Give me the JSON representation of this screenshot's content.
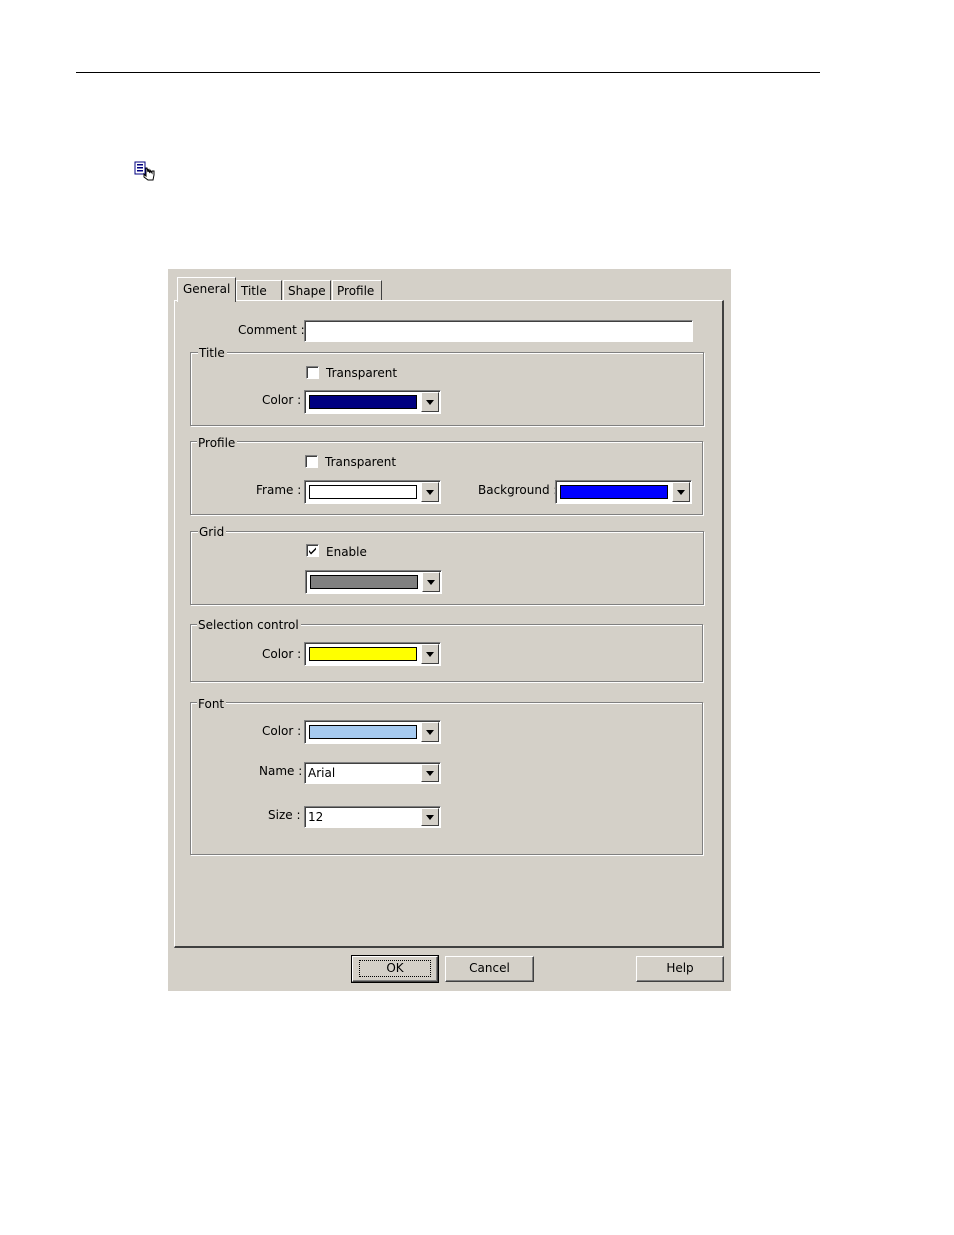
{
  "page": {
    "rule": "horizontal-rule",
    "icon": "properties-hand-icon"
  },
  "dialog": {
    "tabs": [
      {
        "label": "General",
        "active": true
      },
      {
        "label": "Title",
        "active": false
      },
      {
        "label": "Shape",
        "active": false
      },
      {
        "label": "Profile",
        "active": false
      }
    ],
    "comment": {
      "label": "Comment :",
      "value": ""
    },
    "title_group": {
      "legend": "Title",
      "transparent_label": "Transparent",
      "transparent_checked": false,
      "color_label": "Color :",
      "color": "#000080"
    },
    "profile_group": {
      "legend": "Profile",
      "transparent_label": "Transparent",
      "transparent_checked": false,
      "frame_label": "Frame :",
      "frame_color": "#ffffff",
      "background_label": "Background :",
      "background_color": "#0000ff"
    },
    "grid_group": {
      "legend": "Grid",
      "enable_label": "Enable",
      "enable_checked": true,
      "color": "#808080"
    },
    "selection_group": {
      "legend": "Selection control",
      "color_label": "Color :",
      "color": "#ffff00"
    },
    "font_group": {
      "legend": "Font",
      "color_label": "Color :",
      "color": "#a6caf0",
      "name_label": "Name :",
      "name_value": "Arial",
      "size_label": "Size :",
      "size_value": "12"
    },
    "buttons": {
      "ok": "OK",
      "cancel": "Cancel",
      "help": "Help"
    }
  }
}
